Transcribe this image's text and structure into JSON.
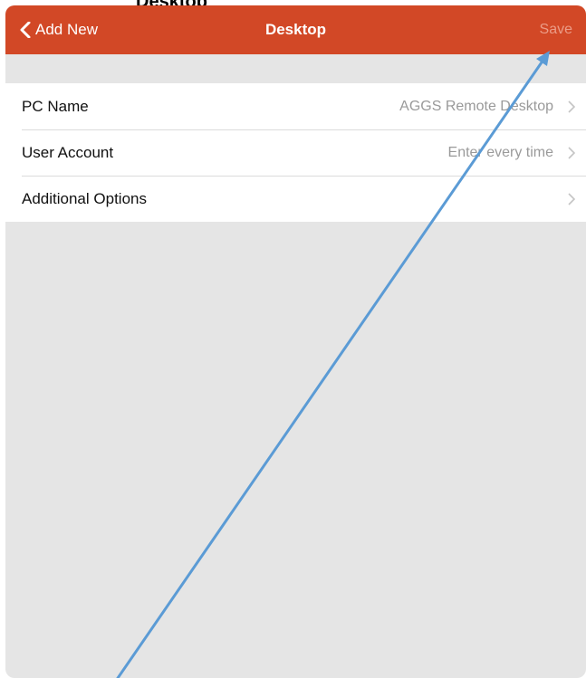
{
  "page_heading": "Desktop",
  "navbar": {
    "back_label": "Add New",
    "title": "Desktop",
    "save_label": "Save",
    "background_color": "#d24826",
    "back_icon": "chevron-left-icon"
  },
  "settings": {
    "rows": [
      {
        "label": "PC Name",
        "value": "AGGS Remote Desktop",
        "icon": "chevron-right-icon"
      },
      {
        "label": "User Account",
        "value": "Enter every time",
        "icon": "chevron-right-icon"
      },
      {
        "label": "Additional Options",
        "value": "",
        "icon": "chevron-right-icon"
      }
    ]
  },
  "annotation": {
    "type": "arrow",
    "color": "#5b9bd5",
    "points_to": "save-button"
  }
}
